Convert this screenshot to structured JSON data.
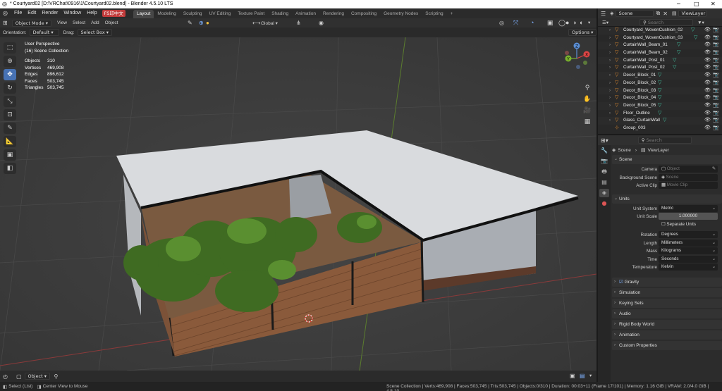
{
  "window": {
    "title": "* Courtyard02 [D:\\VRChat\\0916\\1\\Courtyard02.blend] - Blender 4.5.10 LTS"
  },
  "menu": {
    "items": [
      "File",
      "Edit",
      "Render",
      "Window",
      "Help"
    ],
    "badge": "FS印中文"
  },
  "workspaces": [
    "Layout",
    "Modeling",
    "Sculpting",
    "UV Editing",
    "Texture Paint",
    "Shading",
    "Animation",
    "Rendering",
    "Compositing",
    "Geometry Nodes",
    "Scripting"
  ],
  "active_workspace": "Layout",
  "scene_selector": "Scene",
  "viewlayer_selector": "ViewLayer",
  "viewport_header": {
    "mode": "Object Mode",
    "menus": [
      "View",
      "Select",
      "Add",
      "Object"
    ],
    "transform_orientation": "Global"
  },
  "tool_settings": {
    "orientation_label": "Orientation:",
    "orientation_value": "Default",
    "drag_label": "Drag:",
    "drag_value": "Select Box",
    "options": "Options"
  },
  "viewport_info": {
    "perspective": "User Perspective",
    "collection": "(16) Scene Collection",
    "stats": [
      {
        "key": "Objects",
        "value": "310"
      },
      {
        "key": "Vertices",
        "value": "469,908"
      },
      {
        "key": "Edges",
        "value": "896,612"
      },
      {
        "key": "Faces",
        "value": "503,745"
      },
      {
        "key": "Triangles",
        "value": "503,745"
      }
    ]
  },
  "gizmo_axes": [
    "X",
    "Y",
    "Z"
  ],
  "outliner": {
    "search_placeholder": "Search",
    "items": [
      {
        "name": "Courtyard_WovenCushion_02"
      },
      {
        "name": "Courtyard_WovenCushion_03"
      },
      {
        "name": "CurtainWall_Beam_01"
      },
      {
        "name": "CurtainWall_Beam_02"
      },
      {
        "name": "CurtainWall_Post_01"
      },
      {
        "name": "CurtainWall_Post_02"
      },
      {
        "name": "Decor_Block_01"
      },
      {
        "name": "Decor_Block_02"
      },
      {
        "name": "Decor_Block_03"
      },
      {
        "name": "Decor_Block_04"
      },
      {
        "name": "Decor_Block_05"
      },
      {
        "name": "Floor_Outline"
      },
      {
        "name": "Glass_CurtainWall"
      },
      {
        "name": "Group_003"
      }
    ]
  },
  "properties": {
    "search_placeholder": "Search",
    "breadcrumb": [
      "Scene",
      "ViewLayer"
    ],
    "scene_panel": {
      "title": "Scene",
      "camera_label": "Camera",
      "camera_placeholder": "Object",
      "background_label": "Background Scene",
      "background_placeholder": "Scene",
      "clip_label": "Active Clip",
      "clip_placeholder": "Movie Clip"
    },
    "units_panel": {
      "title": "Units",
      "unit_system_label": "Unit System",
      "unit_system": "Metric",
      "unit_scale_label": "Unit Scale",
      "unit_scale": "1.000000",
      "separate_units": "Separate Units",
      "rotation_label": "Rotation",
      "rotation": "Degrees",
      "length_label": "Length",
      "length": "Millimeters",
      "mass_label": "Mass",
      "mass": "Kilograms",
      "time_label": "Time",
      "time": "Seconds",
      "temperature_label": "Temperature",
      "temperature": "Kelvin"
    },
    "collapsed_panels": [
      "Gravity",
      "Simulation",
      "Keying Sets",
      "Audio",
      "Rigid Body World",
      "Animation",
      "Custom Properties"
    ]
  },
  "viewport_footer": {
    "mode": "Object"
  },
  "statusbar": {
    "select": "Select (List)",
    "center": "Center View to Mouse",
    "stats": "Scene Collection | Verts:469,908 | Faces:503,745 | Tris:503,745 | Objects:0/310 | Duration: 00:03+11 (Frame 17/101) | Memory: 1.16 GiB | VRAM: 2.0/4.0 GiB | 4.5.10"
  },
  "colors": {
    "accent": "#4772b3",
    "object_icon": "#e08a2e",
    "modifier_icon": "#43c7a5",
    "badge": "#c23b3b"
  }
}
